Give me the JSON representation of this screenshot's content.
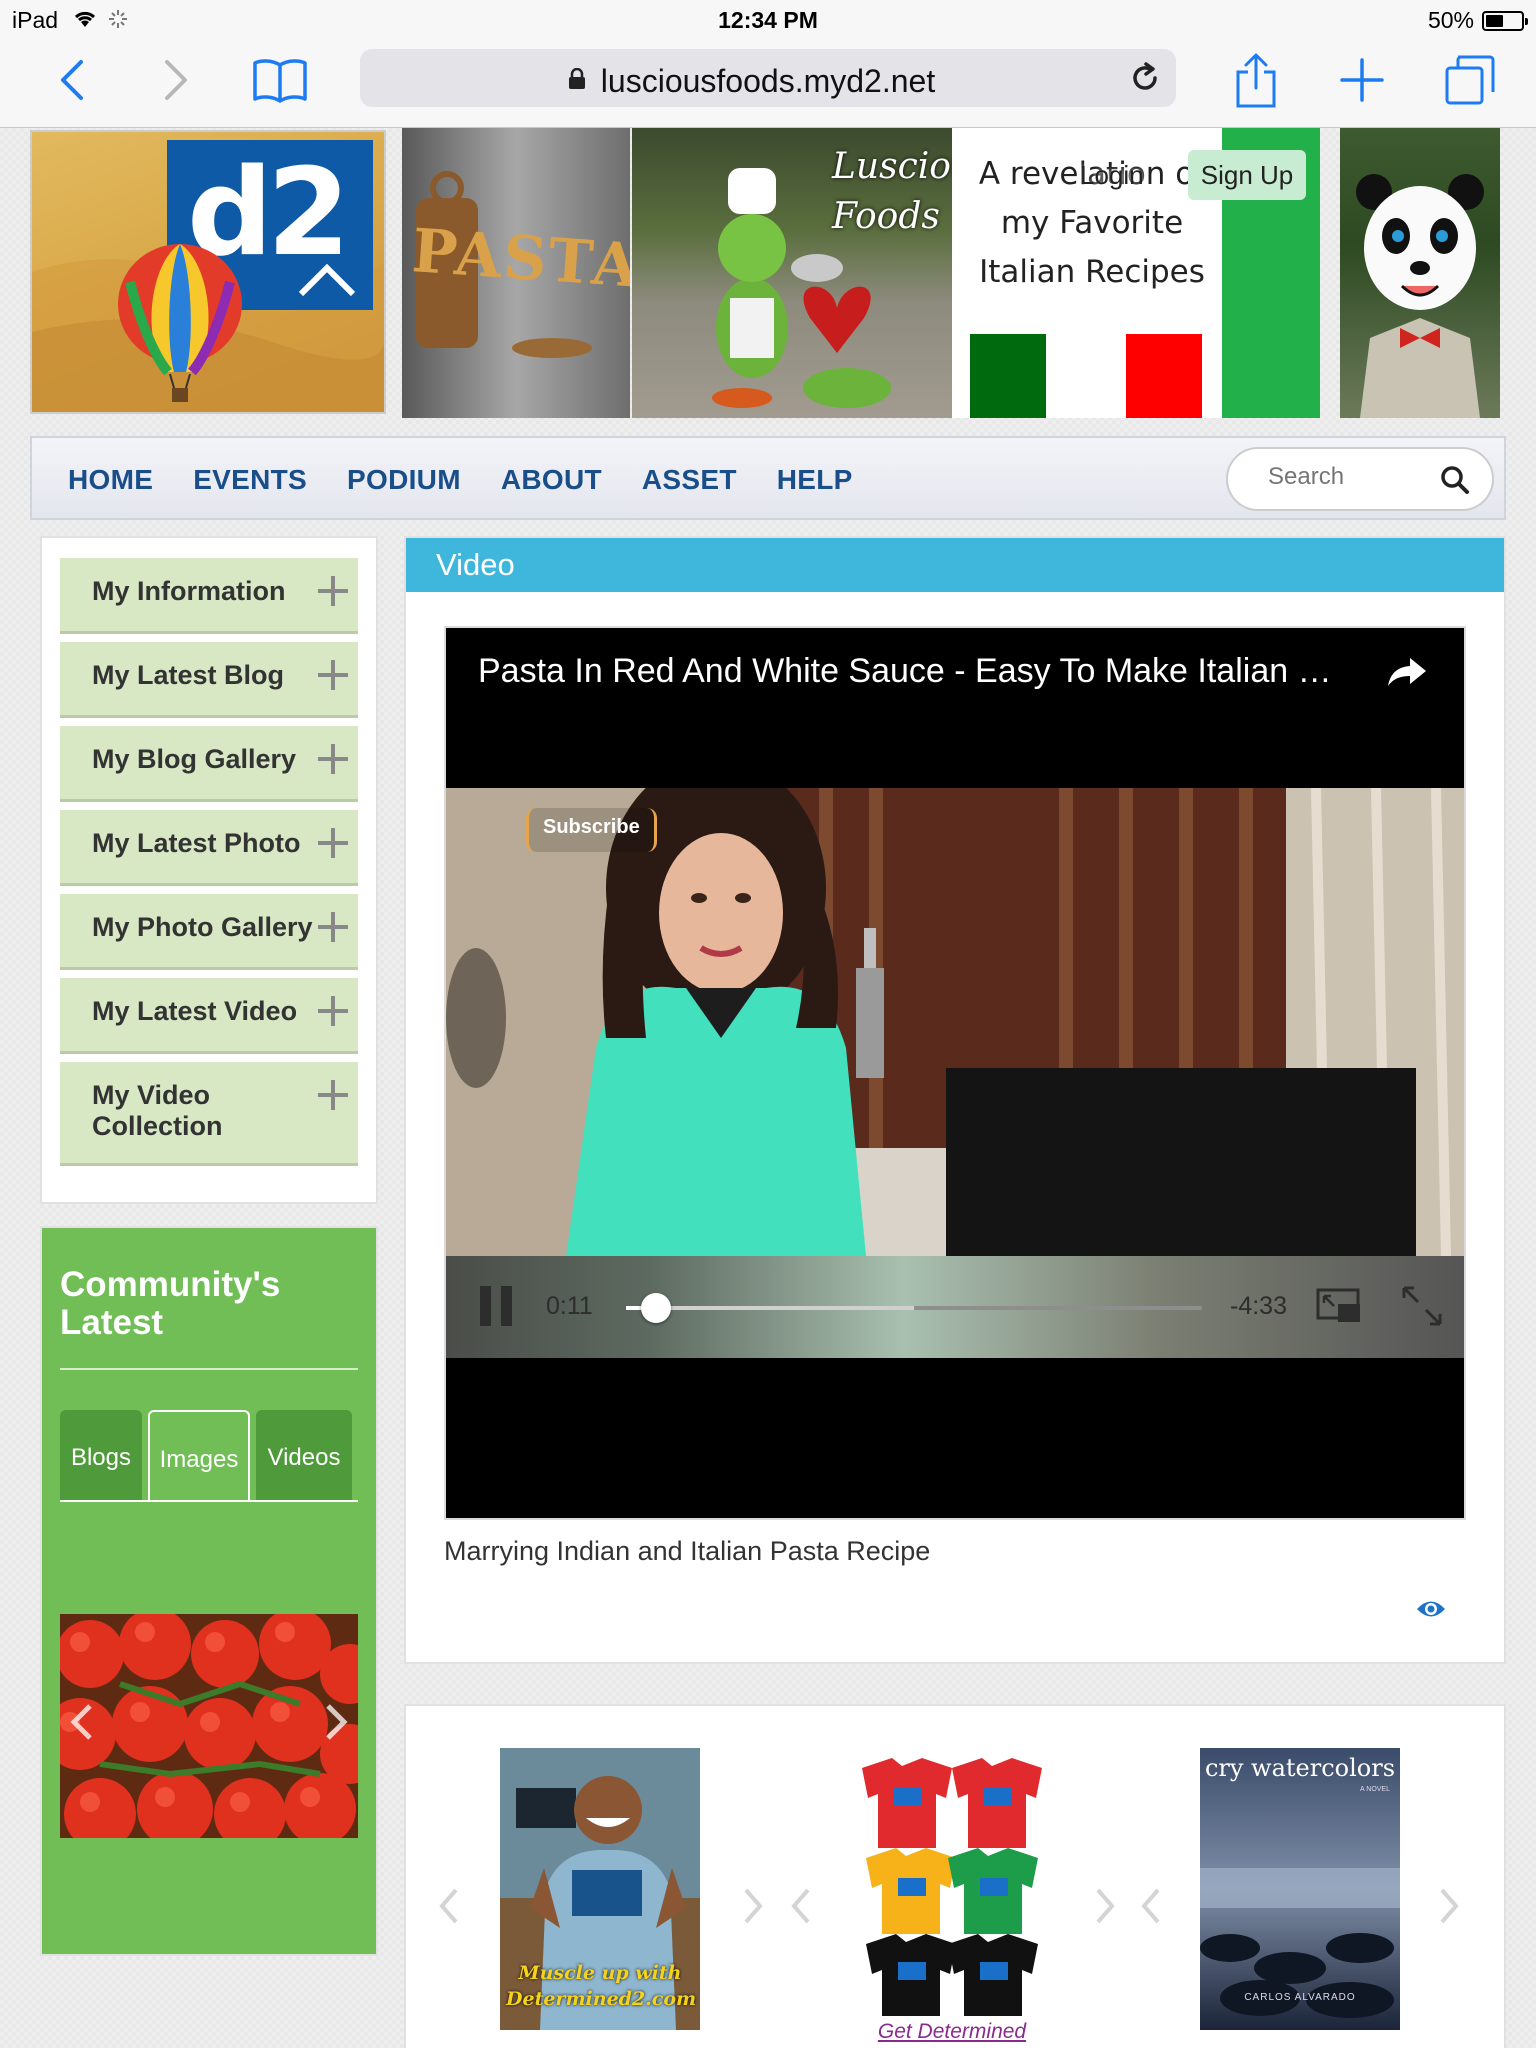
{
  "status_bar": {
    "device": "iPad",
    "time": "12:34 PM",
    "battery": "50%"
  },
  "browser": {
    "url": "lusciousfoods.myd2.net"
  },
  "banner": {
    "d2_logo_text": "d2",
    "pasta_text": "PASTA",
    "brand_text": "Luscious Foods",
    "tagline": "A revelation of my Favorite Italian Recipes",
    "login": "Login",
    "signup": "Sign Up"
  },
  "nav": {
    "items": [
      "HOME",
      "EVENTS",
      "PODIUM",
      "ABOUT",
      "ASSET",
      "HELP"
    ],
    "search_placeholder": "Search"
  },
  "sidebar": {
    "items": [
      {
        "label": "My Information"
      },
      {
        "label": "My Latest Blog"
      },
      {
        "label": "My Blog Gallery"
      },
      {
        "label": "My Latest Photo"
      },
      {
        "label": "My Photo Gallery"
      },
      {
        "label": "My Latest Video"
      },
      {
        "label": "My Video Collection"
      }
    ]
  },
  "community": {
    "title": "Community's Latest",
    "tabs": [
      "Blogs",
      "Images",
      "Videos"
    ],
    "active_tab": "Images"
  },
  "video": {
    "section_title": "Video",
    "title": "Pasta In Red And White Sauce - Easy To Make Italian …",
    "subscribe_badge": "Subscribe",
    "elapsed": "0:11",
    "remaining": "-4:33",
    "progress": 0.04,
    "buffered": 0.5,
    "caption": "Marrying Indian and Italian Pasta Recipe"
  },
  "carousel": {
    "items": [
      {
        "caption": "Muscle up with Determined2.com",
        "name": "muscle-up"
      },
      {
        "caption": "Get Determined",
        "name": "tshirts"
      },
      {
        "caption": "cry watercolors",
        "author": "CARLOS ALVARADO",
        "kind": "A NOVEL",
        "name": "book"
      }
    ]
  },
  "colors": {
    "nav_text": "#1a4e8a",
    "video_header": "#3fb6dc",
    "community_bg": "#70be55",
    "menu_bg": "#d8e8c4",
    "banner_green": "#22b04b",
    "link_purple": "#8b2a8e"
  },
  "icons": [
    "back-icon",
    "forward-icon",
    "bookmarks-icon",
    "lock-icon",
    "reload-icon",
    "share-icon",
    "new-tab-icon",
    "tabs-icon",
    "search-icon",
    "plus-icon",
    "pause-icon",
    "pip-icon",
    "fullscreen-icon",
    "eye-icon",
    "chevron-left-icon",
    "chevron-right-icon"
  ]
}
